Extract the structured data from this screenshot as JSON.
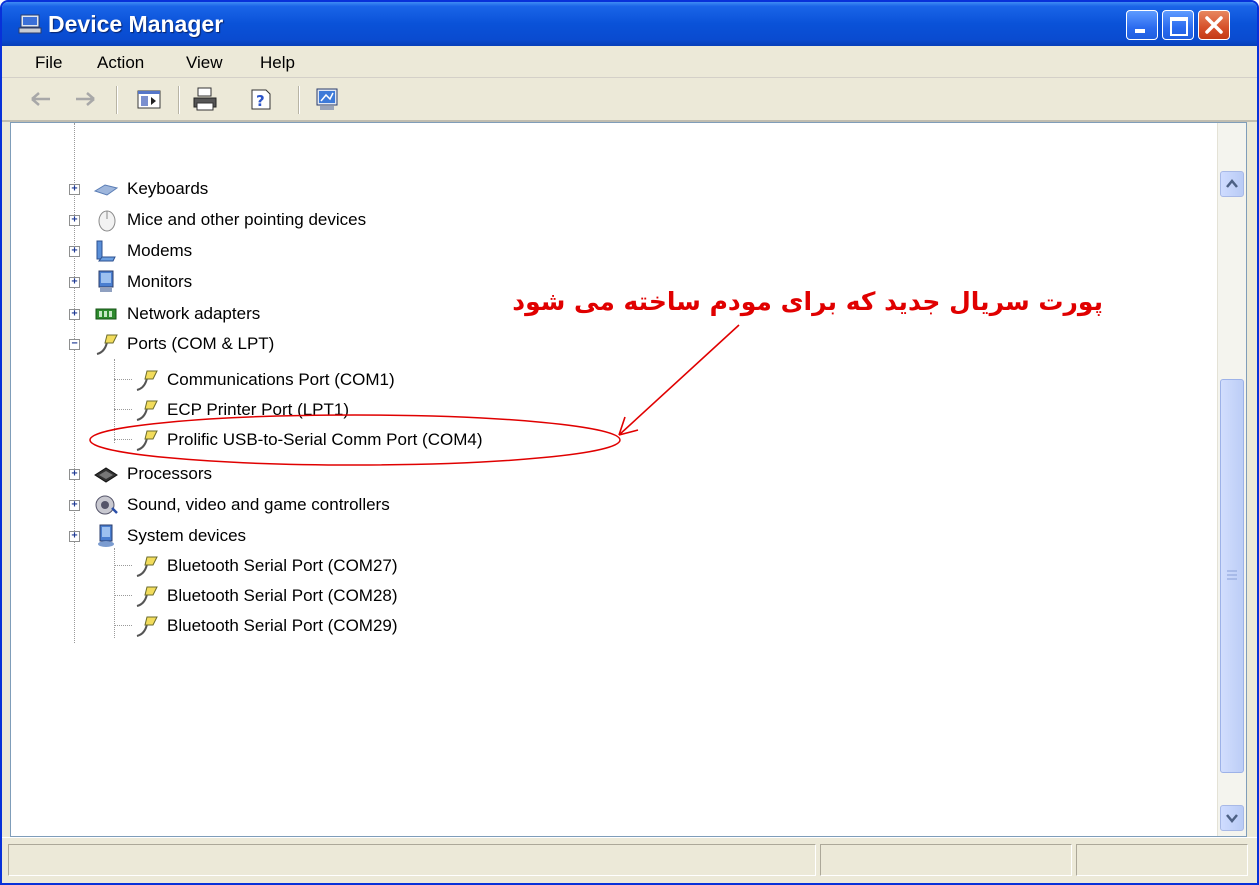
{
  "window": {
    "title": "Device Manager"
  },
  "menu": [
    "File",
    "Action",
    "View",
    "Help"
  ],
  "tree": {
    "categories": [
      {
        "label": "Keyboards",
        "icon": "keyboard-icon",
        "expander": "+"
      },
      {
        "label": "Mice and other pointing devices",
        "icon": "mouse-icon",
        "expander": "+"
      },
      {
        "label": "Modems",
        "icon": "modem-icon",
        "expander": "+"
      },
      {
        "label": "Monitors",
        "icon": "monitor-icon",
        "expander": "+"
      },
      {
        "label": "Network adapters",
        "icon": "network-adapter-icon",
        "expander": "+"
      },
      {
        "label": "Ports (COM & LPT)",
        "icon": "port-icon",
        "expander": "−"
      },
      {
        "label": "Processors",
        "icon": "processor-icon",
        "expander": "+"
      },
      {
        "label": "Sound, video and game controllers",
        "icon": "sound-icon",
        "expander": "+"
      },
      {
        "label": "System devices",
        "icon": "system-device-icon",
        "expander": "+"
      }
    ],
    "ports_children": [
      "Communications Port (COM1)",
      "ECP Printer Port (LPT1)",
      "Prolific USB-to-Serial Comm Port (COM4)"
    ],
    "system_children": [
      "Bluetooth Serial Port (COM27)",
      "Bluetooth Serial Port (COM28)",
      "Bluetooth Serial Port (COM29)"
    ]
  },
  "annotation": {
    "text": "پورت سریال جدید که برای مودم ساخته می شود",
    "color": "#e00000"
  },
  "colors": {
    "titlebar": "#0a52d8",
    "annotation": "#e00000"
  }
}
